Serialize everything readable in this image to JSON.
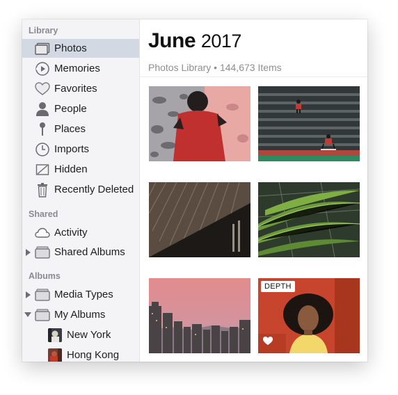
{
  "sidebar": {
    "library_title": "Library",
    "library_items": [
      {
        "label": "Photos",
        "icon": "photos-icon",
        "selected": true
      },
      {
        "label": "Memories",
        "icon": "memories-icon"
      },
      {
        "label": "Favorites",
        "icon": "heart-icon"
      },
      {
        "label": "People",
        "icon": "person-icon"
      },
      {
        "label": "Places",
        "icon": "pin-icon"
      },
      {
        "label": "Imports",
        "icon": "clock-icon"
      },
      {
        "label": "Hidden",
        "icon": "hidden-icon"
      },
      {
        "label": "Recently Deleted",
        "icon": "trash-icon"
      }
    ],
    "shared_title": "Shared",
    "shared_items": [
      {
        "label": "Activity",
        "icon": "cloud-icon"
      },
      {
        "label": "Shared Albums",
        "icon": "folder-icon",
        "disclosure": "collapsed"
      }
    ],
    "albums_title": "Albums",
    "album_items": [
      {
        "label": "Media Types",
        "icon": "folder-icon",
        "disclosure": "collapsed"
      },
      {
        "label": "My Albums",
        "icon": "folder-icon",
        "disclosure": "expanded"
      },
      {
        "label": "New York",
        "icon": "album-thumbnail"
      },
      {
        "label": "Hong Kong",
        "icon": "album-thumbnail"
      }
    ]
  },
  "main": {
    "month": "June",
    "year": "2017",
    "subtitle": "Photos Library • 144,673 Items",
    "photos": [
      {
        "name": "photo-man-sitting-wall"
      },
      {
        "name": "photo-skateboarders-steps"
      },
      {
        "name": "photo-building-facade"
      },
      {
        "name": "photo-palm-fronds"
      },
      {
        "name": "photo-city-skyline-dusk"
      },
      {
        "name": "photo-woman-portrait",
        "badge": "DEPTH",
        "favorite": true
      }
    ]
  },
  "colors": {
    "sidebar_bg": "#f4f3f6",
    "selection": "#d2d9e3",
    "section_title": "#8b8a90"
  }
}
